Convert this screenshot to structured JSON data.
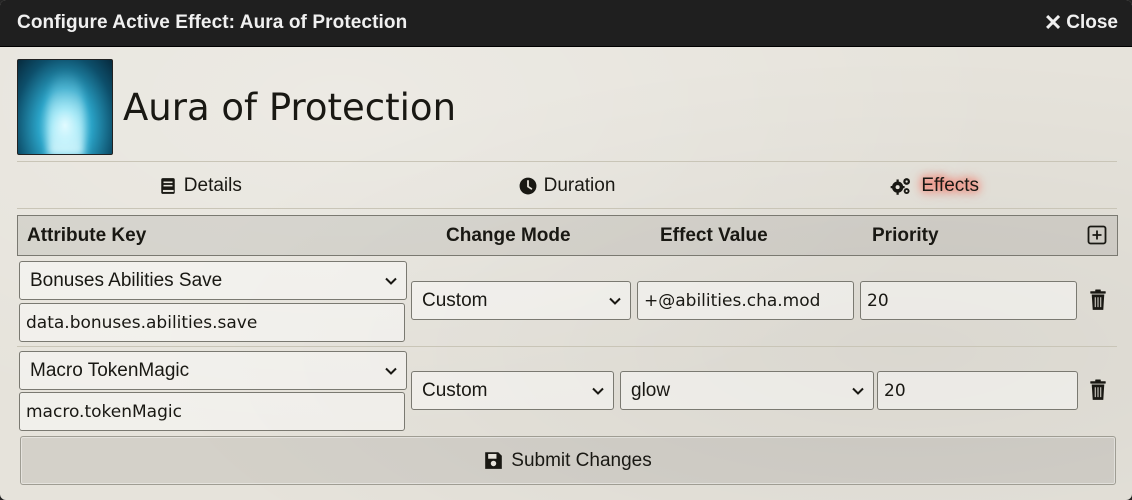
{
  "window": {
    "title": "Configure Active Effect: Aura of Protection",
    "close_label": "Close"
  },
  "effect": {
    "name": "Aura of Protection",
    "portrait_icon": "aura-portrait-image"
  },
  "tabs": [
    {
      "label": "Details",
      "icon": "book-icon",
      "active": false
    },
    {
      "label": "Duration",
      "icon": "clock-icon",
      "active": false
    },
    {
      "label": "Effects",
      "icon": "gears-icon",
      "active": true
    }
  ],
  "table": {
    "headers": {
      "key": "Attribute Key",
      "mode": "Change Mode",
      "value": "Effect Value",
      "priority": "Priority"
    },
    "rows": [
      {
        "key_select": "Bonuses Abilities Save",
        "key_input": "data.bonuses.abilities.save",
        "mode": "Custom",
        "value": "+@abilities.cha.mod",
        "value_is_select": false,
        "priority": "20"
      },
      {
        "key_select": "Macro TokenMagic",
        "key_input": "macro.tokenMagic",
        "mode": "Custom",
        "value": "glow",
        "value_is_select": true,
        "priority": "20"
      }
    ]
  },
  "submit_label": "Submit Changes",
  "colors": {
    "titlebar": "#1f1f1f",
    "background": "#e6e3db",
    "active_glow": "#ff4b3a"
  }
}
